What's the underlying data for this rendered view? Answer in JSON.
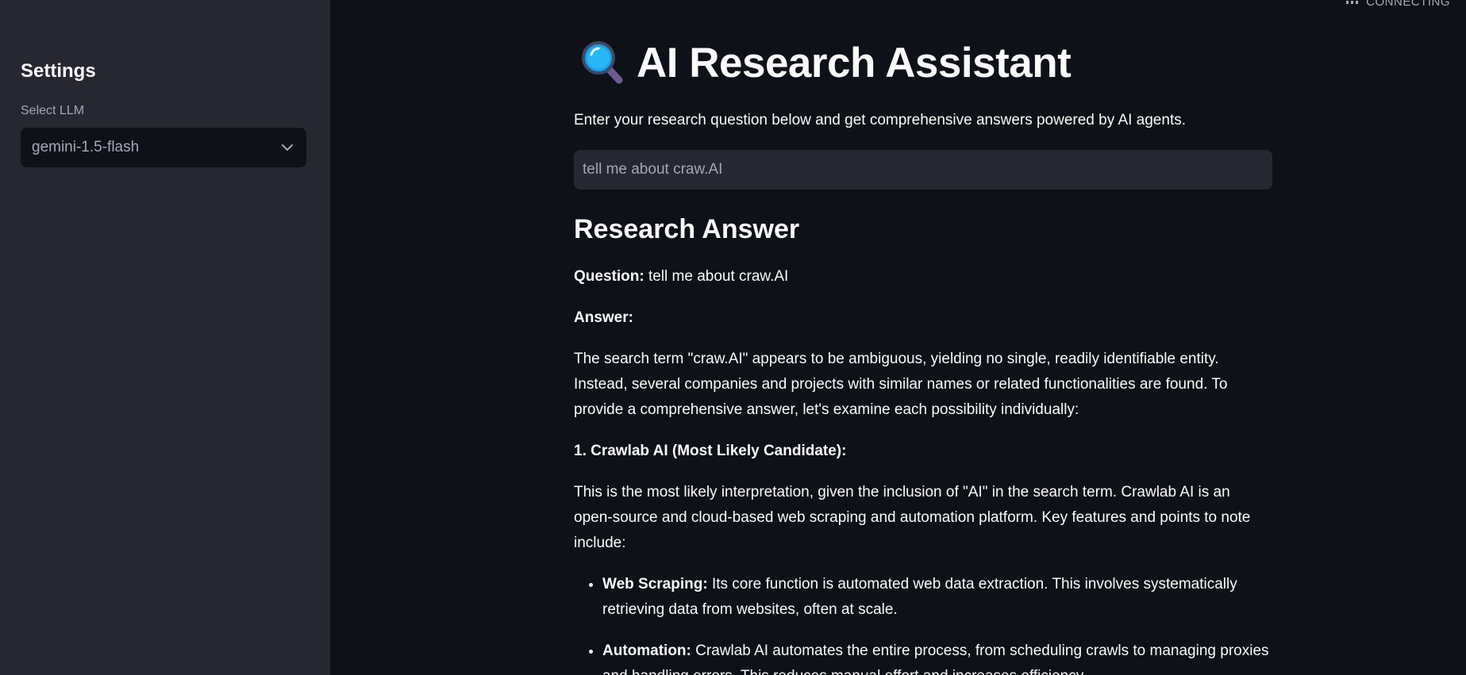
{
  "status": {
    "text": "CONNECTING"
  },
  "sidebar": {
    "title": "Settings",
    "select_label": "Select LLM",
    "select_value": "gemini-1.5-flash"
  },
  "main": {
    "title": "AI Research Assistant",
    "title_icon": "magnifying-glass-icon",
    "intro": "Enter your research question below and get comprehensive answers powered by AI agents.",
    "input_value": "tell me about craw.AI",
    "answer_heading": "Research Answer",
    "question_label": "Question:",
    "question_text": "tell me about craw.AI",
    "answer_label": "Answer:",
    "paragraph_1": "The search term \"craw.AI\" appears to be ambiguous, yielding no single, readily identifiable entity. Instead, several companies and projects with similar names or related functionalities are found. To provide a comprehensive answer, let's examine each possibility individually:",
    "section_1_heading": "1. Crawlab AI (Most Likely Candidate):",
    "paragraph_2": "This is the most likely interpretation, given the inclusion of \"AI\" in the search term. Crawlab AI is an open-source and cloud-based web scraping and automation platform. Key features and points to note include:",
    "bullets": [
      {
        "label": "Web Scraping:",
        "text": " Its core function is automated web data extraction. This involves systematically retrieving data from websites, often at scale."
      },
      {
        "label": "Automation:",
        "text": " Crawlab AI automates the entire process, from scheduling crawls to managing proxies and handling errors. This reduces manual effort and increases efficiency."
      }
    ]
  },
  "colors": {
    "background": "#0e1117",
    "sidebar": "#262730",
    "text": "#fafafa",
    "muted": "#a3a8b8"
  }
}
